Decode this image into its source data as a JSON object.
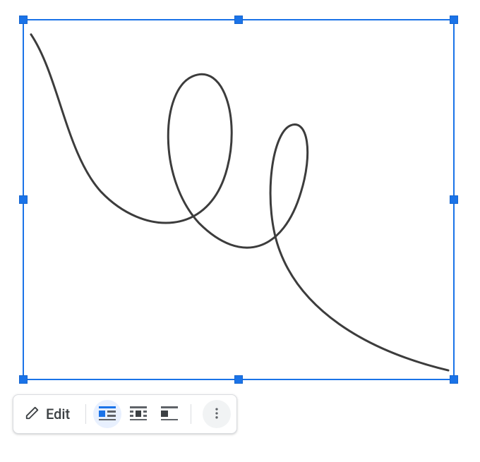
{
  "selection": {
    "accent_color": "#1a73e8",
    "drawing_stroke_color": "#3c3c3c"
  },
  "toolbar": {
    "edit_label": "Edit",
    "wrap_options": {
      "inline": "In line",
      "wrap": "Wrap text",
      "break": "Break text"
    },
    "active_wrap": "inline"
  }
}
